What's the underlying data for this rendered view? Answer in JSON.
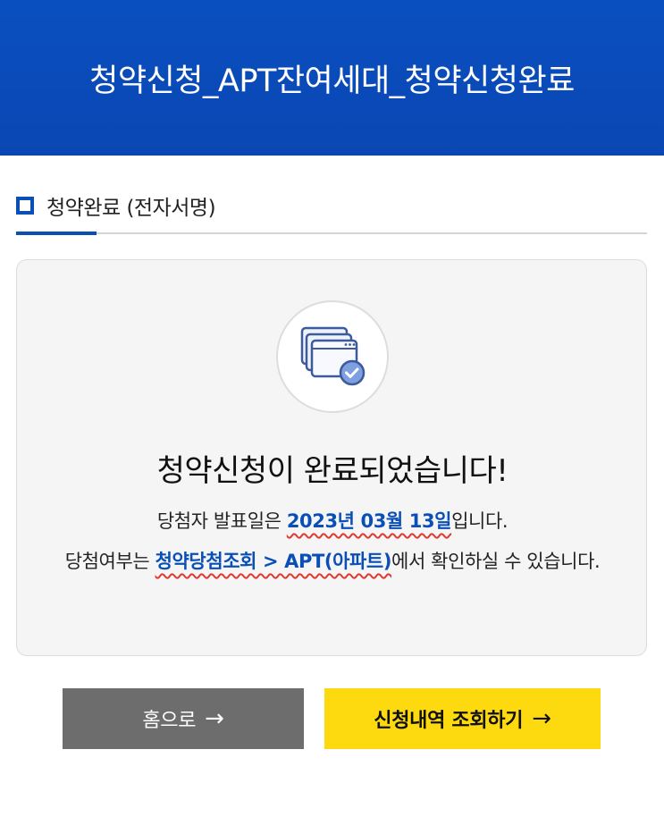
{
  "header": {
    "title": "청약신청_APT잔여세대_청약신청완료"
  },
  "section": {
    "title": "청약완료 (전자서명)"
  },
  "card": {
    "icon": "documents-check-icon",
    "title": "청약신청이 완료되었습니다!",
    "line1_pre": "당첨자 발표일은 ",
    "line1_date": "2023년 03월 13일",
    "line1_post": "입니다.",
    "line2_pre": "당첨여부는 ",
    "line2_link": "청약당첨조회 > APT(아파트)",
    "line2_post": "에서 확인하실 수 있습니다."
  },
  "buttons": {
    "home_label": "홈으로",
    "history_label": "신청내역 조회하기",
    "arrow": "→"
  },
  "colors": {
    "header_blue": "#0a4fc0",
    "accent_blue": "#0a4fb5",
    "home_gray": "#6d6d6d",
    "history_yellow": "#fdd90f",
    "underline_red": "#e03a2f"
  }
}
